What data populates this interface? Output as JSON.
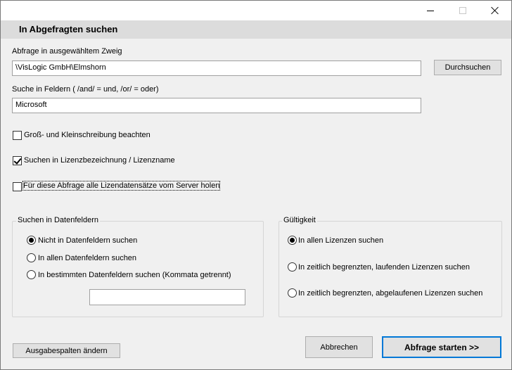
{
  "window": {
    "header_title": "In Abgefragten suchen"
  },
  "query": {
    "label": "Abfrage in ausgewähltem Zweig",
    "value": "\\VisLogic GmbH\\Elmshorn",
    "browse_label": "Durchsuchen"
  },
  "fields_search": {
    "label": "Suche in Feldern ( /and/ = und, /or/ = oder)",
    "value": "Microsoft"
  },
  "options": {
    "case_label": "Groß- und Kleinschreibung beachten",
    "case_checked": false,
    "license_name_label": "Suchen in Lizenzbezeichnung / Lizenzname",
    "license_name_checked": true,
    "fetch_all_label": "Für diese Abfrage alle Lizendatensätze vom Server holen",
    "fetch_all_checked": false
  },
  "datafields_group": {
    "title": "Suchen in Datenfeldern",
    "options": [
      {
        "label": "Nicht in Datenfeldern suchen",
        "selected": true
      },
      {
        "label": "In allen Datenfeldern suchen",
        "selected": false
      },
      {
        "label": "In bestimmten Datenfeldern suchen (Kommata getrennt)",
        "selected": false
      }
    ],
    "specific_fields_value": ""
  },
  "validity_group": {
    "title": "Gültigkeit",
    "options": [
      {
        "label": "In allen Lizenzen suchen",
        "selected": true
      },
      {
        "label": "In zeitlich begrenzten, laufenden Lizenzen suchen",
        "selected": false
      },
      {
        "label": "In zeitlich begrenzten, abgelaufenen Lizenzen suchen",
        "selected": false
      }
    ]
  },
  "footer": {
    "output_columns_label": "Ausgabespalten ändern",
    "cancel_label": "Abbrechen",
    "start_label": "Abfrage starten >>"
  }
}
